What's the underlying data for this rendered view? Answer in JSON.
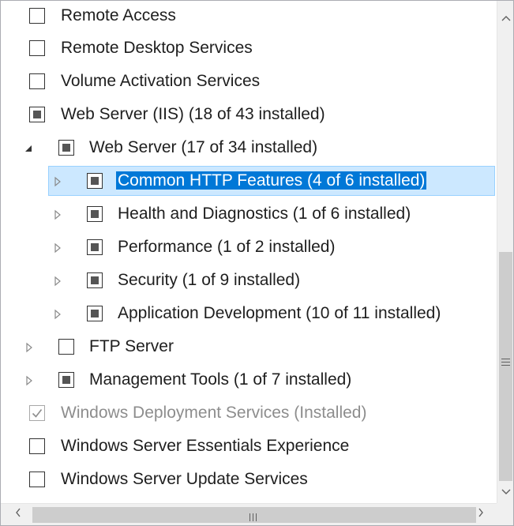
{
  "tree": {
    "rows": [
      {
        "label": "Remote Access",
        "state": "unchecked"
      },
      {
        "label": "Remote Desktop Services",
        "state": "unchecked"
      },
      {
        "label": "Volume Activation Services",
        "state": "unchecked"
      },
      {
        "label": "Web Server (IIS) (18 of 43 installed)",
        "state": "partial"
      },
      {
        "label": "Web Server (17 of 34 installed)",
        "state": "partial",
        "expander": "expanded"
      },
      {
        "label": "Common HTTP Features (4 of 6 installed)",
        "state": "partial",
        "expander": "collapsed",
        "selected": true
      },
      {
        "label": "Health and Diagnostics (1 of 6 installed)",
        "state": "partial",
        "expander": "collapsed"
      },
      {
        "label": "Performance (1 of 2 installed)",
        "state": "partial",
        "expander": "collapsed"
      },
      {
        "label": "Security (1 of 9 installed)",
        "state": "partial",
        "expander": "collapsed"
      },
      {
        "label": "Application Development (10 of 11 installed)",
        "state": "partial",
        "expander": "collapsed"
      },
      {
        "label": "FTP Server",
        "state": "unchecked",
        "expander": "collapsed"
      },
      {
        "label": "Management Tools (1 of 7 installed)",
        "state": "partial",
        "expander": "collapsed"
      },
      {
        "label": "Windows Deployment Services (Installed)",
        "state": "checked-disabled"
      },
      {
        "label": "Windows Server Essentials Experience",
        "state": "unchecked"
      },
      {
        "label": "Windows Server Update Services",
        "state": "unchecked"
      }
    ]
  },
  "colors": {
    "selection_fill": "#cce8ff",
    "selection_text_bg": "#0078d7",
    "disabled_text": "#8d8d8d",
    "scrollbar_thumb": "#cdcdcd"
  }
}
